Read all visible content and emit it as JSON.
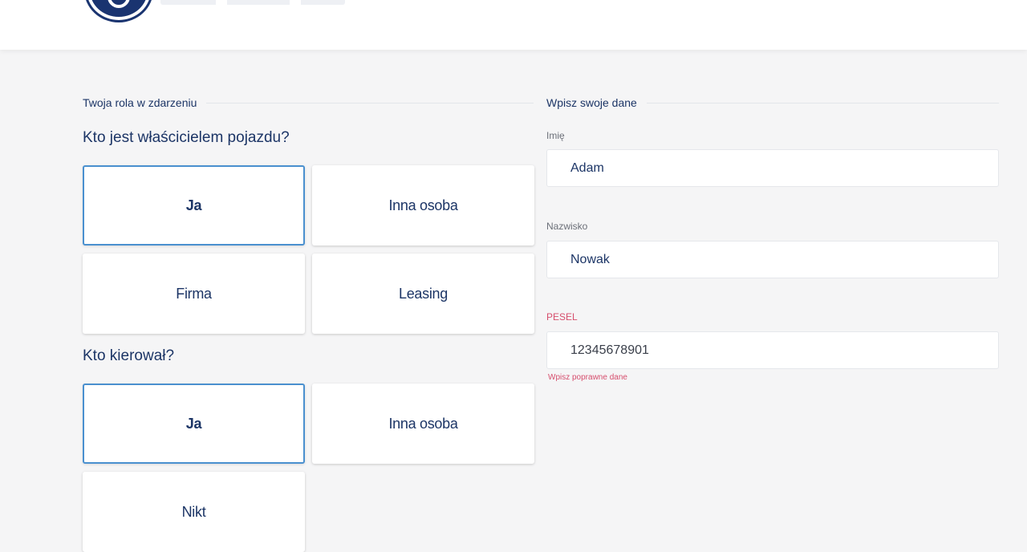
{
  "left_section": {
    "title": "Twoja rola w zdarzeniu",
    "owner_question": "Kto jest właścicielem pojazdu?",
    "owner_options": [
      "Ja",
      "Inna osoba",
      "Firma",
      "Leasing"
    ],
    "owner_selected": "Ja",
    "driver_question": "Kto kierował?",
    "driver_options": [
      "Ja",
      "Inna osoba",
      "Nikt"
    ],
    "driver_selected": "Ja"
  },
  "right_section": {
    "title": "Wpisz swoje dane",
    "first_name": {
      "label": "Imię",
      "value": "Adam"
    },
    "last_name": {
      "label": "Nazwisko",
      "value": "Nowak"
    },
    "pesel": {
      "label": "PESEL",
      "value": "12345678901",
      "error": "Wpisz poprawne dane"
    }
  },
  "colors": {
    "primary": "#1c3566",
    "selected_border": "#4a90cf",
    "error": "#d64e6d",
    "background": "#f5f5f6"
  }
}
